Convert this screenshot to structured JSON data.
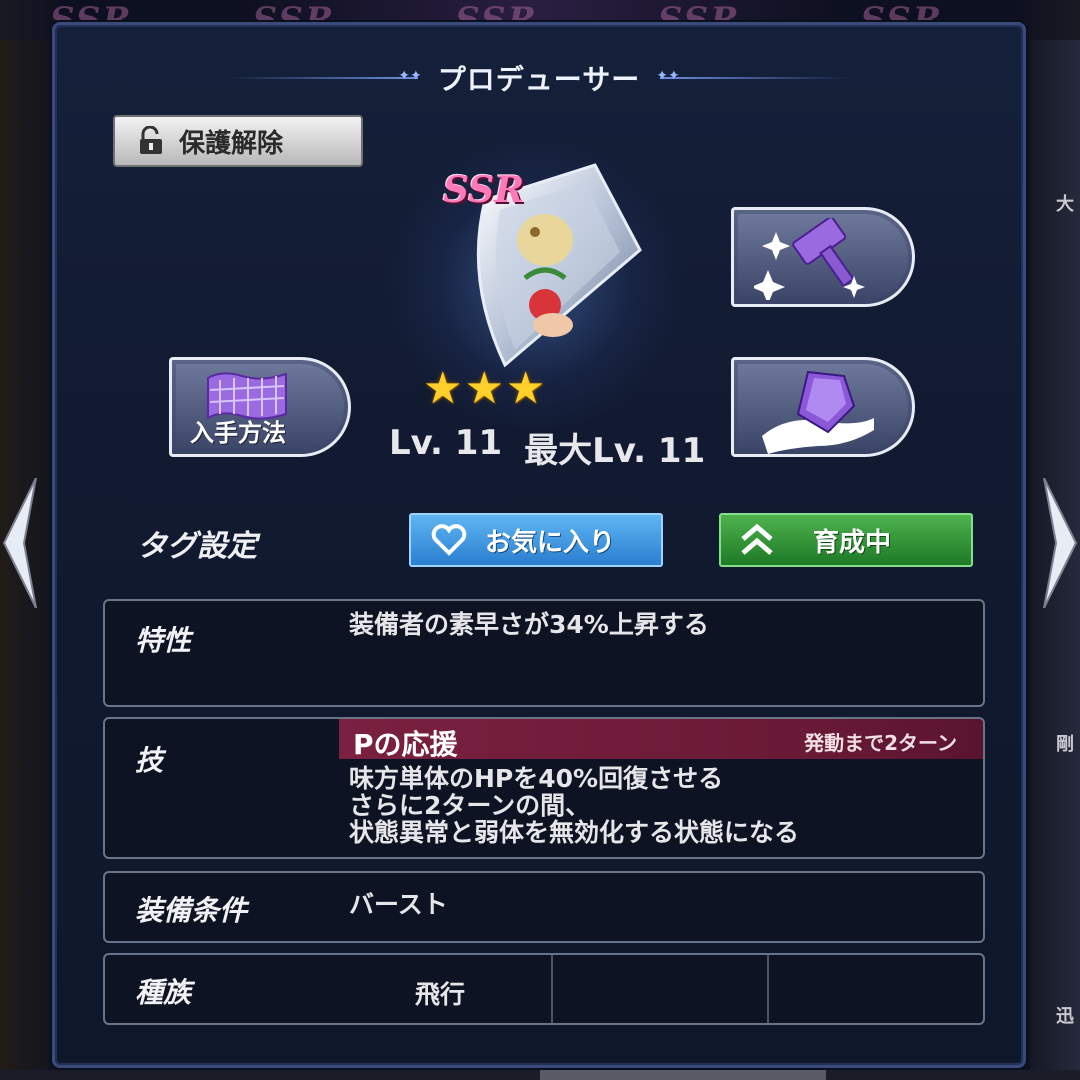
{
  "background": {
    "top_text": [
      "SSR",
      "SSR",
      "SSR",
      "SSR",
      "SSR"
    ],
    "right_side_glyphs": [
      "大",
      "剛",
      "迅"
    ]
  },
  "dialog": {
    "title": "プロデューサー"
  },
  "protect_button": {
    "label": "保護解除",
    "icon": "unlock-icon"
  },
  "item": {
    "rarity": "SSR",
    "stars": 3,
    "level_text": "Lv. 11",
    "max_level_text": "最大Lv. 11"
  },
  "buttons": {
    "how_to_obtain": {
      "label": "入手方法",
      "icon": "map-scroll-icon"
    },
    "enhance": {
      "icon": "hammer-sparkle-icon"
    },
    "equip": {
      "icon": "gem-hand-icon"
    }
  },
  "tags": {
    "label": "タグ設定",
    "favorite": {
      "label": "お気に入り",
      "icon": "heart-icon",
      "color": "#2a7ed0"
    },
    "training": {
      "label": "育成中",
      "icon": "double-chevron-up-icon",
      "color": "#1e7a26"
    }
  },
  "trait": {
    "label": "特性",
    "text": "装備者の素早さが34%上昇する"
  },
  "skill": {
    "label": "技",
    "name": "Pの応援",
    "cooldown": "発動まで2ターン",
    "description": [
      "味方単体のHPを40%回復させる",
      "さらに2ターンの間、",
      "状態異常と弱体を無効化する状態になる"
    ],
    "header_color": "#7a2040"
  },
  "equip_condition": {
    "label": "装備条件",
    "value": "バースト"
  },
  "race": {
    "label": "種族",
    "values": [
      "飛行",
      "",
      ""
    ]
  }
}
